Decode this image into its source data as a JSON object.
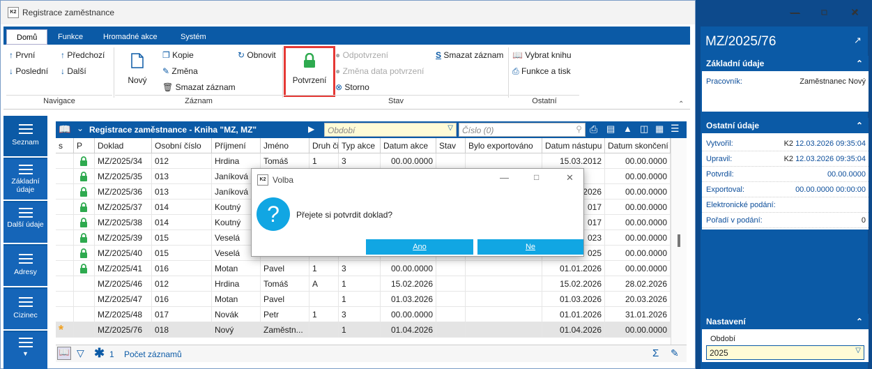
{
  "window": {
    "title": "Registrace zaměstnance",
    "logo": "K2"
  },
  "ribbon": {
    "tabs": [
      "Domů",
      "Funkce",
      "Hromadné akce",
      "Systém"
    ],
    "nav": {
      "first": "První",
      "prev": "Předchozí",
      "last": "Poslední",
      "next": "Další",
      "group": "Navigace"
    },
    "record": {
      "new": "Nový",
      "copy": "Kopie",
      "refresh": "Obnovit",
      "change": "Změna",
      "delete": "Smazat záznam",
      "group": "Záznam"
    },
    "state": {
      "confirm": "Potvrzení",
      "unconfirm": "Odpotvrzení",
      "change_date": "Změna data potvrzení",
      "cancel": "Storno",
      "delete": "Smazat záznam",
      "group": "Stav"
    },
    "other": {
      "book": "Vybrat knihu",
      "print": "Funkce a tisk",
      "group": "Ostatní"
    }
  },
  "sidebar": [
    "Seznam",
    "Základní údaje",
    "Další údaje",
    "Adresy",
    "Cizinec"
  ],
  "grid": {
    "title": "Registrace zaměstnance - Kniha \"MZ, MZ\"",
    "period_placeholder": "Období",
    "number_placeholder": "Číslo (0)",
    "columns": [
      "s",
      "P",
      "Doklad",
      "Osobní číslo",
      "Příjmení",
      "Jméno",
      "Druh či",
      "Typ akce",
      "Datum akce",
      "Stav",
      "Bylo exportováno",
      "Datum nástupu",
      "Datum skončení"
    ],
    "rows": [
      {
        "s": "",
        "p": true,
        "doklad": "MZ/2025/34",
        "oc": "012",
        "prijmeni": "Hrdina",
        "jmeno": "Tomáš",
        "druh": "1",
        "typ": "3",
        "datum_akce": "00.00.0000",
        "stav": "",
        "exp": "",
        "nastup": "15.03.2012",
        "skonceni": "00.00.0000"
      },
      {
        "s": "",
        "p": true,
        "doklad": "MZ/2025/35",
        "oc": "013",
        "prijmeni": "Janíková",
        "jmeno": "",
        "druh": "",
        "typ": "",
        "datum_akce": "",
        "stav": "",
        "exp": "",
        "nastup": "",
        "skonceni": "00.00.0000"
      },
      {
        "s": "",
        "p": true,
        "doklad": "MZ/2025/36",
        "oc": "013",
        "prijmeni": "Janíková",
        "jmeno": "",
        "druh": "",
        "typ": "",
        "datum_akce": "",
        "stav": "",
        "exp": "",
        "nastup": "2026",
        "skonceni": "00.00.0000"
      },
      {
        "s": "",
        "p": true,
        "doklad": "MZ/2025/37",
        "oc": "014",
        "prijmeni": "Koutný",
        "jmeno": "",
        "druh": "",
        "typ": "",
        "datum_akce": "",
        "stav": "",
        "exp": "",
        "nastup": "017",
        "skonceni": "00.00.0000"
      },
      {
        "s": "",
        "p": true,
        "doklad": "MZ/2025/38",
        "oc": "014",
        "prijmeni": "Koutný",
        "jmeno": "",
        "druh": "",
        "typ": "",
        "datum_akce": "",
        "stav": "",
        "exp": "",
        "nastup": "017",
        "skonceni": "00.00.0000"
      },
      {
        "s": "",
        "p": true,
        "doklad": "MZ/2025/39",
        "oc": "015",
        "prijmeni": "Veselá",
        "jmeno": "",
        "druh": "",
        "typ": "",
        "datum_akce": "",
        "stav": "",
        "exp": "",
        "nastup": "023",
        "skonceni": "00.00.0000"
      },
      {
        "s": "",
        "p": true,
        "doklad": "MZ/2025/40",
        "oc": "015",
        "prijmeni": "Veselá",
        "jmeno": "",
        "druh": "",
        "typ": "",
        "datum_akce": "",
        "stav": "",
        "exp": "",
        "nastup": "025",
        "skonceni": "00.00.0000"
      },
      {
        "s": "",
        "p": true,
        "doklad": "MZ/2025/41",
        "oc": "016",
        "prijmeni": "Motan",
        "jmeno": "Pavel",
        "druh": "1",
        "typ": "3",
        "datum_akce": "00.00.0000",
        "stav": "",
        "exp": "",
        "nastup": "01.01.2026",
        "skonceni": "00.00.0000"
      },
      {
        "s": "",
        "p": false,
        "doklad": "MZ/2025/46",
        "oc": "012",
        "prijmeni": "Hrdina",
        "jmeno": "Tomáš",
        "druh": "A",
        "typ": "1",
        "datum_akce": "15.02.2026",
        "stav": "",
        "exp": "",
        "nastup": "15.02.2026",
        "skonceni": "28.02.2026"
      },
      {
        "s": "",
        "p": false,
        "doklad": "MZ/2025/47",
        "oc": "016",
        "prijmeni": "Motan",
        "jmeno": "Pavel",
        "druh": "",
        "typ": "1",
        "datum_akce": "01.03.2026",
        "stav": "",
        "exp": "",
        "nastup": "01.03.2026",
        "skonceni": "20.03.2026"
      },
      {
        "s": "",
        "p": false,
        "doklad": "MZ/2025/48",
        "oc": "017",
        "prijmeni": "Novák",
        "jmeno": "Petr",
        "druh": "1",
        "typ": "3",
        "datum_akce": "00.00.0000",
        "stav": "",
        "exp": "",
        "nastup": "01.01.2026",
        "skonceni": "31.01.2026"
      },
      {
        "s": "*",
        "p": false,
        "doklad": "MZ/2025/76",
        "oc": "018",
        "prijmeni": "Nový",
        "jmeno": "Zaměstn...",
        "druh": "",
        "typ": "1",
        "datum_akce": "01.04.2026",
        "stav": "",
        "exp": "",
        "nastup": "01.04.2026",
        "skonceni": "00.00.0000"
      }
    ],
    "footer": {
      "count": "1",
      "label": "Počet záznamů"
    }
  },
  "right": {
    "doc": "MZ/2025/76",
    "basic": {
      "title": "Základní údaje",
      "label": "Pracovník:",
      "value": "Zaměstnanec Nový"
    },
    "other": {
      "title": "Ostatní údaje",
      "rows": [
        {
          "label": "Vytvořil:",
          "user": "K2",
          "value": "12.03.2026 09:35:04"
        },
        {
          "label": "Upravil:",
          "user": "K2",
          "value": "12.03.2026 09:35:04"
        },
        {
          "label": "Potvrdil:",
          "user": "",
          "value": "00.00.0000"
        },
        {
          "label": "Exportoval:",
          "user": "",
          "value": "00.00.0000 00:00:00"
        },
        {
          "label": "Elektronické podání:",
          "user": "",
          "value": ""
        },
        {
          "label": "Pořadí v podání:",
          "user": "",
          "value": "0"
        }
      ]
    },
    "settings": {
      "title": "Nastavení",
      "label": "Období",
      "value": "2025"
    }
  },
  "dialog": {
    "title": "Volba",
    "message": "Přejete si potvrdit doklad?",
    "yes": "Ano",
    "no": "Ne"
  },
  "colors": {
    "brand": "#0b5aa6",
    "accent": "#11a6e3",
    "highlight": "#e53935"
  }
}
